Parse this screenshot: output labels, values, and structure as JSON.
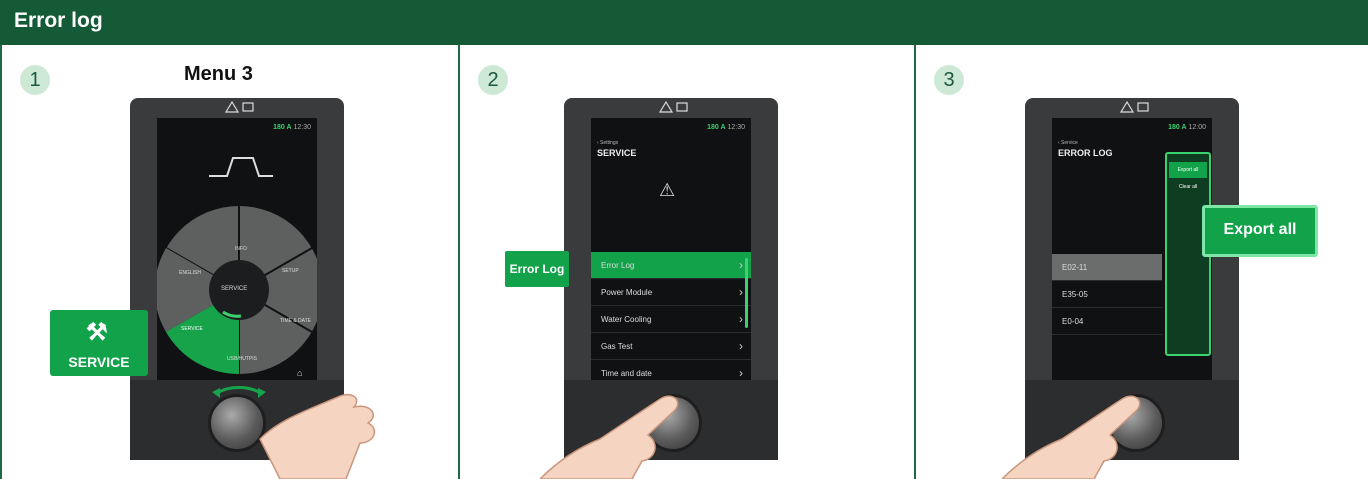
{
  "header": {
    "title": "Error log"
  },
  "panels": [
    {
      "step": "1",
      "title": "Menu 3",
      "screen": {
        "status_current": "180 A",
        "status_time": "12:30",
        "wheel_center": "SERVICE",
        "wheel_items": [
          "INFO",
          "SETUP",
          "TIME & DATE",
          "USB/HUTPIS",
          "SERVICE",
          "ENGLISH"
        ]
      },
      "callout": {
        "label": "SERVICE",
        "icon": "service-tools-icon"
      }
    },
    {
      "step": "2",
      "screen": {
        "status_current": "180 A",
        "status_time": "12:30",
        "back": "‹ Settings",
        "title": "SERVICE",
        "items": [
          "Error Log",
          "Power Module",
          "Water Cooling",
          "Gas Test",
          "Time and date"
        ]
      },
      "callout": {
        "label": "Error Log"
      }
    },
    {
      "step": "3",
      "screen": {
        "status_current": "180 A",
        "status_time": "12:00",
        "back": "‹ Service",
        "title": "ERROR LOG",
        "entries": [
          "E02-11",
          "E35-05",
          "E0-04"
        ],
        "popup_items": [
          "Export all",
          "Clear all"
        ]
      },
      "callout": {
        "label": "Export all"
      }
    }
  ],
  "colors": {
    "brand_green": "#145a36",
    "accent_green": "#12a24a",
    "device": "#3a3b3d"
  }
}
